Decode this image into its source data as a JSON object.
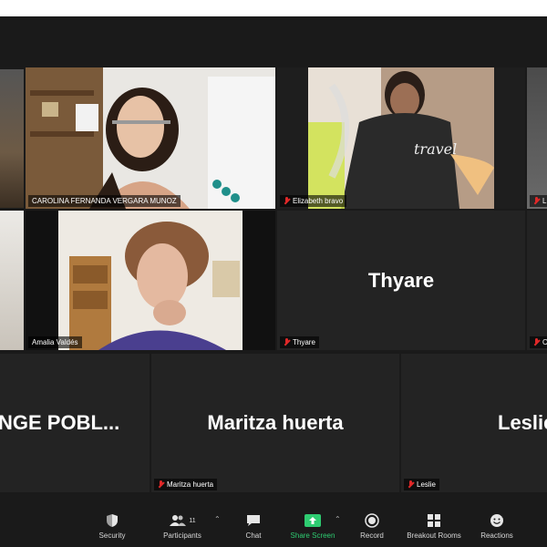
{
  "tiles": {
    "carolina": {
      "label": "CAROLINA FERNANDA VERGARA MUNOZ"
    },
    "elizabeth": {
      "label": "Elizabeth bravo"
    },
    "amalia": {
      "label": "Amalia Valdés"
    },
    "thyare": {
      "name": "Thyare",
      "label": "Thyare"
    },
    "partial_left": {
      "name": "NGE  POBL..."
    },
    "maritza": {
      "name": "Maritza huerta",
      "label": "Maritza huerta"
    },
    "leslie": {
      "name": "Leslie",
      "label": "Leslie"
    },
    "edge_label_1": {
      "label": "L"
    },
    "edge_label_2": {
      "label": "C"
    }
  },
  "toolbar": {
    "security": "Security",
    "participants": "Participants",
    "participants_count": "11",
    "chat": "Chat",
    "share_screen": "Share Screen",
    "record": "Record",
    "breakout_rooms": "Breakout Rooms",
    "reactions": "Reactions"
  },
  "colors": {
    "active_speaker": "#c6d94b",
    "mute": "#e02828",
    "share_screen": "#2ecc71",
    "background": "#1a1a1a",
    "tile": "#232323"
  }
}
